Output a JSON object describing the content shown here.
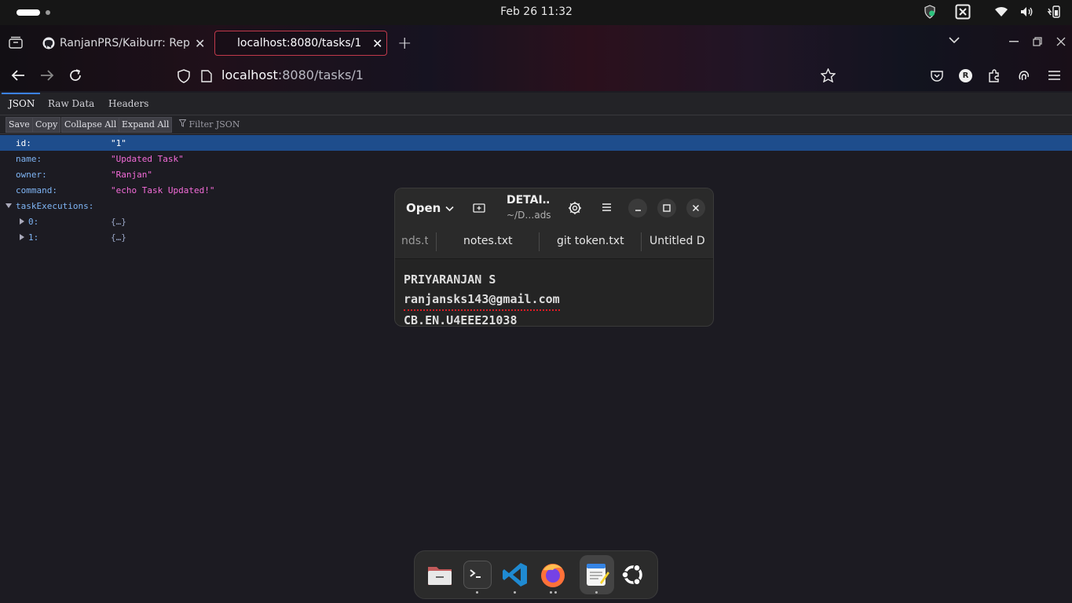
{
  "system": {
    "clock": "Feb 26  11:32",
    "tray_icons": [
      "shield-icon",
      "screenshot-icon",
      "wifi-icon",
      "volume-icon",
      "battery-icon"
    ]
  },
  "browser": {
    "tabs": [
      {
        "title": "RanjanPRS/Kaiburr: Rep",
        "icon": "github-icon",
        "active": false
      },
      {
        "title": "localhost:8080/tasks/1",
        "active": true
      }
    ],
    "url_host": "localhost",
    "url_rest": ":8080/tasks/1"
  },
  "viewer": {
    "tabs": [
      "JSON",
      "Raw Data",
      "Headers"
    ],
    "buttons": [
      "Save",
      "Copy",
      "Collapse All",
      "Expand All"
    ],
    "filter_placeholder": "Filter JSON",
    "rows": [
      {
        "key": "id:",
        "value": "\"1\""
      },
      {
        "key": "name:",
        "value": "\"Updated Task\""
      },
      {
        "key": "owner:",
        "value": "\"Ranjan\""
      },
      {
        "key": "command:",
        "value": "\"echo Task Updated!\""
      },
      {
        "key": "taskExecutions:",
        "value": ""
      },
      {
        "key": "0:",
        "value": "{…}"
      },
      {
        "key": "1:",
        "value": "{…}"
      }
    ]
  },
  "editor": {
    "open_label": "Open",
    "title": "DETAI…",
    "subtitle": "~/D…ads",
    "tabs": [
      "nds.t",
      "notes.txt",
      "git token.txt",
      "Untitled D"
    ],
    "lines": [
      "PRIYARANJAN S",
      "ranjansks143@gmail.com",
      "CB.EN.U4EEE21038"
    ]
  },
  "dock": {
    "apps": [
      "files-icon",
      "terminal-icon",
      "vscode-icon",
      "firefox-icon",
      "text-editor-icon",
      "ubuntu-icon"
    ]
  }
}
